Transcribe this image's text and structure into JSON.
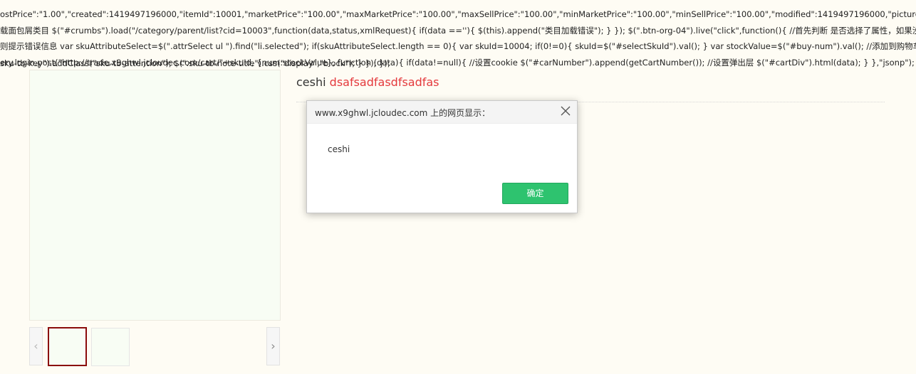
{
  "code": {
    "line1": "ostPrice\":\"1.00\",\"created\":1419497196000,\"itemId\":10001,\"marketPrice\":\"100.00\",\"maxMarketPrice\":\"100.00\",\"maxSellPrice\":\"100.00\",\"minMarketPrice\":\"100.00\",\"minSellPrice\":\"100.00\",\"modified\":1419497196000,\"pictureUrl\":\"ht",
    "line2": "载面包屑类目 $(\"#crumbs\").load(\"/category/parent/list?cid=10003\",function(data,status,xmlRequest){ if(data ==''){ $(this).append(\"类目加载错误\"); } }); $(\".btn-org-04\").live(\"click\",function(){ //首先判断 是否选择了属性，如果没有选",
    "line3": "则提示错误信息 var skuAttributeSelect=$(\".attrSelect ul \").find(\"li.selected\"); if(skuAttributeSelect.length == 0){ var skuId=10004; if(0!=0){ skuId=$(\"#selectSkuId\").val(); } var stockValue=$(\"#buy-num\").val(); //添加到购物车",
    "line4": "ery.login.post(\"http://trade.x9ghwl.jcloudec.com/cart/\"+skuId, {num:stockValue}, function (data){ if(data!=null){ //设置cookie $(\"#carNumber\").append(getCartNumber()); //设置弹出层 $(\"#cartDiv\").html(data); } },\"jsonp\"); }else",
    "line5": "sku-tb-key\").addClass(\"sku-tb-attention\"); $(\".sku-tb-note-title\").css(\"display\",\"block\"); } }); });"
  },
  "product": {
    "name": "ceshi",
    "subtitle": "dsafsadfasdfsadfas"
  },
  "gallery": {
    "prev_arrow": "‹",
    "next_arrow": "›"
  },
  "dialog": {
    "title": "www.x9ghwl.jcloudec.com 上的网页显示：",
    "message": "ceshi",
    "ok_label": "确定",
    "close_icon": "close-icon"
  },
  "colors": {
    "subtitle": "#e4393c",
    "ok_button": "#2ec36f",
    "selected_thumb_border": "#8b0b0b"
  }
}
